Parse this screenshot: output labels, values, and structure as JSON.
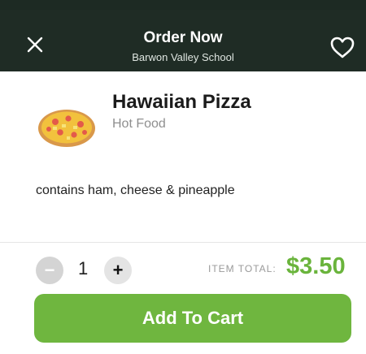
{
  "header": {
    "title": "Order Now",
    "subtitle": "Barwon Valley School",
    "close_icon": "close-icon",
    "favorite_icon": "heart-icon",
    "background_color": "#1f2c25"
  },
  "product": {
    "name": "Hawaiian Pizza",
    "category": "Hot Food",
    "description": "contains ham, cheese & pineapple",
    "image_icon": "pizza-icon"
  },
  "order": {
    "minus_icon": "minus-icon",
    "minus_label": "−",
    "quantity": "1",
    "plus_icon": "plus-icon",
    "plus_label": "+",
    "total_label": "ITEM TOTAL:",
    "total_value": "$3.50",
    "total_color": "#6ab43c"
  },
  "cta": {
    "add_to_cart_label": "Add To Cart",
    "button_color": "#6fb63f"
  }
}
